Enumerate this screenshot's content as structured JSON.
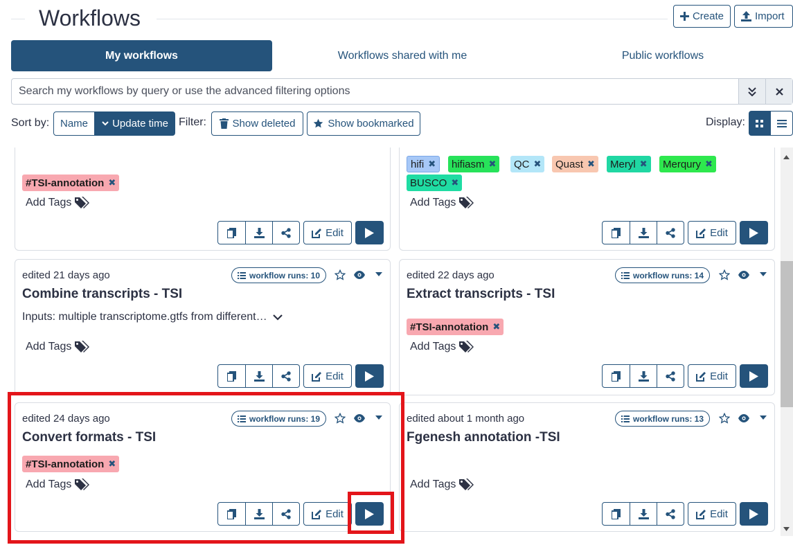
{
  "header": {
    "title": "Workflows",
    "create_label": "Create",
    "import_label": "Import"
  },
  "tabs": [
    {
      "label": "My workflows",
      "active": true
    },
    {
      "label": "Workflows shared with me",
      "active": false
    },
    {
      "label": "Public workflows",
      "active": false
    }
  ],
  "search": {
    "placeholder": "Search my workflows by query or use the advanced filtering options"
  },
  "toolbar": {
    "sort_label": "Sort by:",
    "sort_name": "Name",
    "sort_update": "Update time",
    "filter_label": "Filter:",
    "show_deleted": "Show deleted",
    "show_bookmarked": "Show bookmarked",
    "display_label": "Display:"
  },
  "common": {
    "add_tags": "Add Tags",
    "edit": "Edit"
  },
  "cards": [
    {
      "edited": "",
      "name": "",
      "tags": [
        {
          "label": "#TSI-annotation",
          "color": "#f8a8b0"
        }
      ]
    },
    {
      "edited": "",
      "name": "",
      "tags": [
        {
          "label": "hifi",
          "color": "#a7c8f7"
        },
        {
          "label": "hifiasm",
          "color": "#27e25a"
        },
        {
          "label": "QC",
          "color": "#b3e6f8"
        },
        {
          "label": "Quast",
          "color": "#f8c7b0"
        },
        {
          "label": "Meryl",
          "color": "#20d7a3"
        },
        {
          "label": "Merqury",
          "color": "#2ee84e"
        },
        {
          "label": "BUSCO",
          "color": "#1fdca3"
        }
      ]
    },
    {
      "edited": "edited 21 days ago",
      "name": "Combine transcripts - TSI",
      "runs": "workflow runs: 10",
      "description": "Inputs: multiple transcriptome.gtfs from different…",
      "tags": []
    },
    {
      "edited": "edited 22 days ago",
      "name": "Extract transcripts - TSI",
      "runs": "workflow runs: 14",
      "tags": [
        {
          "label": "#TSI-annotation",
          "color": "#f8a8b0"
        }
      ]
    },
    {
      "edited": "edited 24 days ago",
      "name": "Convert formats - TSI",
      "runs": "workflow runs: 19",
      "tags": [
        {
          "label": "#TSI-annotation",
          "color": "#f8a8b0"
        }
      ]
    },
    {
      "edited": "edited about 1 month ago",
      "name": "Fgenesh annotation -TSI",
      "runs": "workflow runs: 13",
      "tags": []
    }
  ],
  "colors": {
    "primary": "#25537b",
    "highlight": "#e3151a"
  }
}
